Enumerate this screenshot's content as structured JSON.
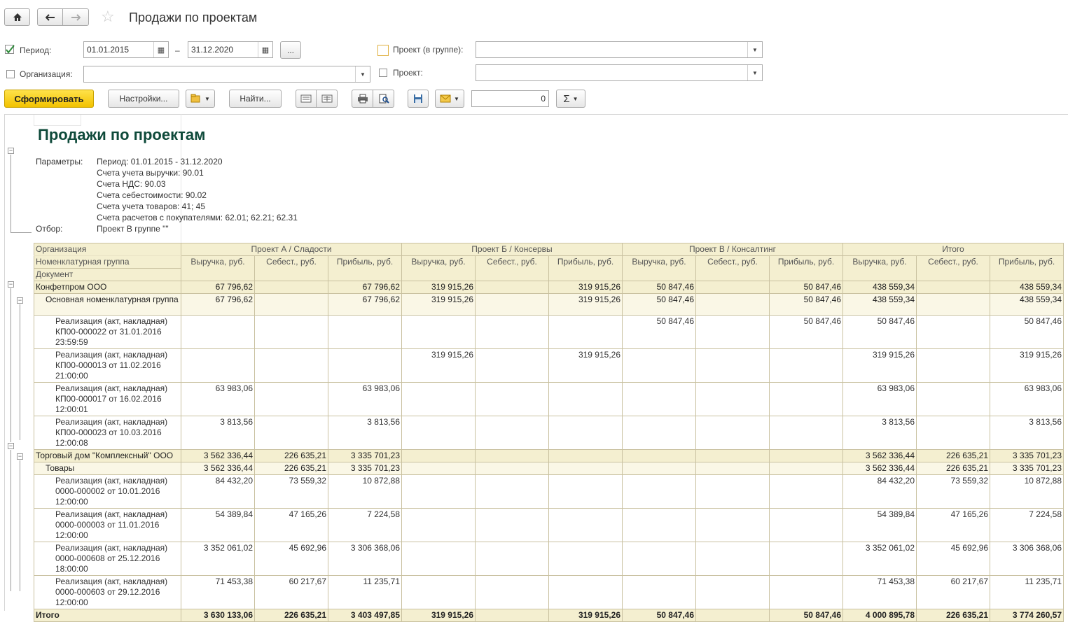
{
  "window": {
    "title": "Продажи по проектам"
  },
  "filters": {
    "period_label": "Период:",
    "period_checked": true,
    "date_from": "01.01.2015",
    "date_sep": "–",
    "date_to": "31.12.2020",
    "more": "...",
    "org_label": "Организация:",
    "org_value": "",
    "project_group_label": "Проект (в группе):",
    "project_group_value": "",
    "project_label": "Проект:",
    "project_value": ""
  },
  "toolbar": {
    "generate": "Сформировать",
    "settings": "Настройки...",
    "find": "Найти...",
    "sum_value": "0"
  },
  "report": {
    "title": "Продажи по проектам",
    "params_label": "Параметры:",
    "params": [
      "Период: 01.01.2015 - 31.12.2020",
      "Счета учета выручки: 90.01",
      "Счета НДС: 90.03",
      "Счета себестоимости: 90.02",
      "Счета учета товаров: 41; 45",
      "Счета расчетов с покупателями: 62.01; 62.21; 62.31"
    ],
    "filter_label": "Отбор:",
    "filter_value": "Проект В группе \"\"",
    "headers": {
      "org": "Организация",
      "group": "Номенклатурная группа",
      "doc": "Документ",
      "projects": [
        "Проект А / Сладости",
        "Проект Б / Консервы",
        "Проект В / Консалтинг",
        "Итого"
      ],
      "cols": [
        "Выручка, руб.",
        "Себест., руб.",
        "Прибыль, руб."
      ]
    },
    "rows": [
      {
        "level": 1,
        "label": "Конфетпром ООО",
        "v": [
          "67 796,62",
          "",
          "67 796,62",
          "319 915,26",
          "",
          "319 915,26",
          "50 847,46",
          "",
          "50 847,46",
          "438 559,34",
          "",
          "438 559,34"
        ]
      },
      {
        "level": 2,
        "label": "Основная номенклатурная группа",
        "v": [
          "67 796,62",
          "",
          "67 796,62",
          "319 915,26",
          "",
          "319 915,26",
          "50 847,46",
          "",
          "50 847,46",
          "438 559,34",
          "",
          "438 559,34"
        ]
      },
      {
        "level": 3,
        "label": "Реализация (акт, накладная) КП00-000022 от 31.01.2016 23:59:59",
        "v": [
          "",
          "",
          "",
          "",
          "",
          "",
          "50 847,46",
          "",
          "50 847,46",
          "50 847,46",
          "",
          "50 847,46"
        ]
      },
      {
        "level": 3,
        "label": "Реализация (акт, накладная) КП00-000013 от 11.02.2016 21:00:00",
        "v": [
          "",
          "",
          "",
          "319 915,26",
          "",
          "319 915,26",
          "",
          "",
          "",
          "319 915,26",
          "",
          "319 915,26"
        ]
      },
      {
        "level": 3,
        "label": "Реализация (акт, накладная) КП00-000017 от 16.02.2016 12:00:01",
        "v": [
          "63 983,06",
          "",
          "63 983,06",
          "",
          "",
          "",
          "",
          "",
          "",
          "63 983,06",
          "",
          "63 983,06"
        ]
      },
      {
        "level": 3,
        "label": "Реализация (акт, накладная) КП00-000023 от 10.03.2016 12:00:08",
        "v": [
          "3 813,56",
          "",
          "3 813,56",
          "",
          "",
          "",
          "",
          "",
          "",
          "3 813,56",
          "",
          "3 813,56"
        ]
      },
      {
        "level": 1,
        "label": "Торговый дом \"Комплексный\" ООО",
        "v": [
          "3 562 336,44",
          "226 635,21",
          "3 335 701,23",
          "",
          "",
          "",
          "",
          "",
          "",
          "3 562 336,44",
          "226 635,21",
          "3 335 701,23"
        ]
      },
      {
        "level": 2,
        "label": "Товары",
        "v": [
          "3 562 336,44",
          "226 635,21",
          "3 335 701,23",
          "",
          "",
          "",
          "",
          "",
          "",
          "3 562 336,44",
          "226 635,21",
          "3 335 701,23"
        ]
      },
      {
        "level": 3,
        "label": "Реализация (акт, накладная) 0000-000002 от 10.01.2016 12:00:00",
        "v": [
          "84 432,20",
          "73 559,32",
          "10 872,88",
          "",
          "",
          "",
          "",
          "",
          "",
          "84 432,20",
          "73 559,32",
          "10 872,88"
        ]
      },
      {
        "level": 3,
        "label": "Реализация (акт, накладная) 0000-000003 от 11.01.2016 12:00:00",
        "v": [
          "54 389,84",
          "47 165,26",
          "7 224,58",
          "",
          "",
          "",
          "",
          "",
          "",
          "54 389,84",
          "47 165,26",
          "7 224,58"
        ]
      },
      {
        "level": 3,
        "label": "Реализация (акт, накладная) 0000-000608 от 25.12.2016 18:00:00",
        "v": [
          "3 352 061,02",
          "45 692,96",
          "3 306 368,06",
          "",
          "",
          "",
          "",
          "",
          "",
          "3 352 061,02",
          "45 692,96",
          "3 306 368,06"
        ]
      },
      {
        "level": 3,
        "label": "Реализация (акт, накладная) 0000-000603 от 29.12.2016 12:00:00",
        "v": [
          "71 453,38",
          "60 217,67",
          "11 235,71",
          "",
          "",
          "",
          "",
          "",
          "",
          "71 453,38",
          "60 217,67",
          "11 235,71"
        ]
      }
    ],
    "total": {
      "label": "Итого",
      "v": [
        "3 630 133,06",
        "226 635,21",
        "3 403 497,85",
        "319 915,26",
        "",
        "319 915,26",
        "50 847,46",
        "",
        "50 847,46",
        "4 000 895,78",
        "226 635,21",
        "3 774 260,57"
      ]
    }
  }
}
